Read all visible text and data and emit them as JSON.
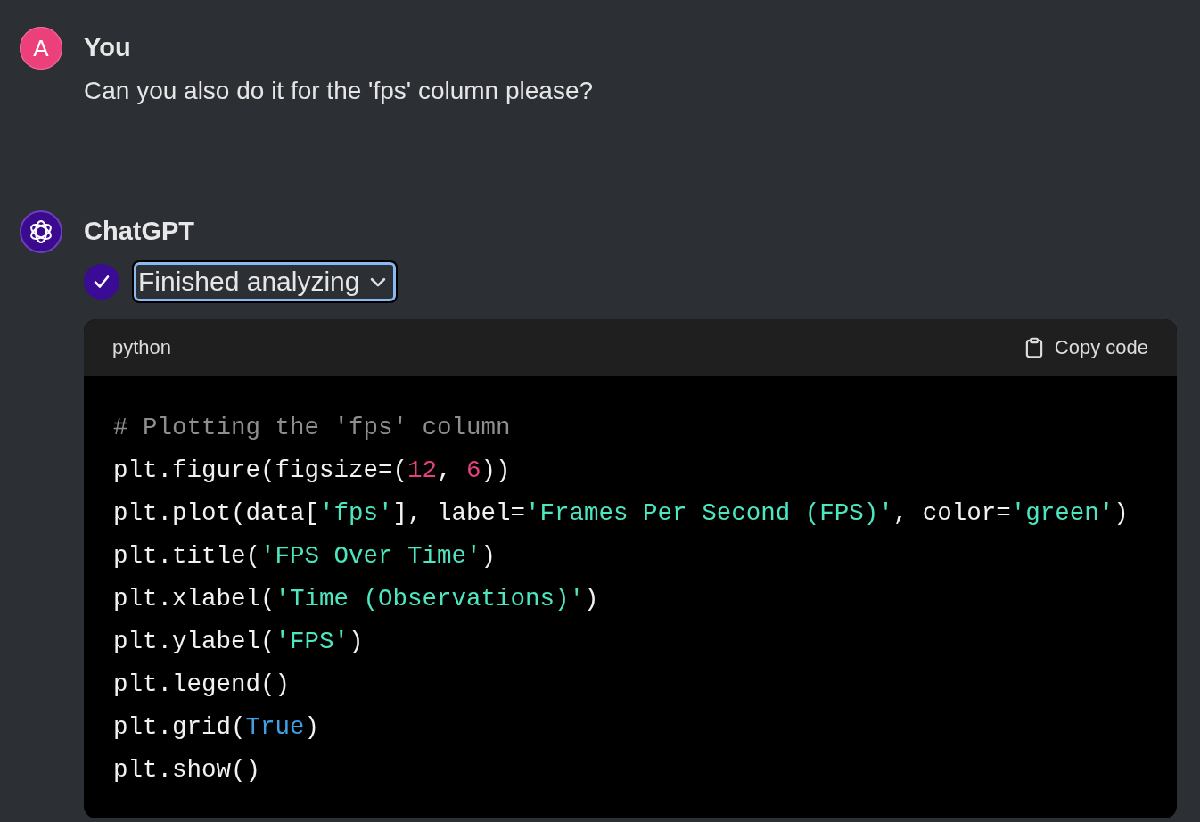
{
  "messages": [
    {
      "kind": "user",
      "avatar_letter": "A",
      "author": "You",
      "text": "Can you also do it for the 'fps' column please?"
    },
    {
      "kind": "assistant",
      "author": "ChatGPT",
      "status": {
        "label": "Finished analyzing",
        "expanded": false
      },
      "code_block": {
        "language": "python",
        "copy_label": "Copy code",
        "lines": [
          [
            {
              "kind": "comment",
              "text": "# Plotting the 'fps' column"
            }
          ],
          [
            {
              "kind": "plain",
              "text": "plt.figure(figsize=("
            },
            {
              "kind": "number",
              "text": "12"
            },
            {
              "kind": "plain",
              "text": ", "
            },
            {
              "kind": "number",
              "text": "6"
            },
            {
              "kind": "plain",
              "text": "))"
            }
          ],
          [
            {
              "kind": "plain",
              "text": "plt.plot(data["
            },
            {
              "kind": "string",
              "text": "'fps'"
            },
            {
              "kind": "plain",
              "text": "], label="
            },
            {
              "kind": "string",
              "text": "'Frames Per Second (FPS)'"
            },
            {
              "kind": "plain",
              "text": ", color="
            },
            {
              "kind": "string",
              "text": "'green'"
            },
            {
              "kind": "plain",
              "text": ")"
            }
          ],
          [
            {
              "kind": "plain",
              "text": "plt.title("
            },
            {
              "kind": "string",
              "text": "'FPS Over Time'"
            },
            {
              "kind": "plain",
              "text": ")"
            }
          ],
          [
            {
              "kind": "plain",
              "text": "plt.xlabel("
            },
            {
              "kind": "string",
              "text": "'Time (Observations)'"
            },
            {
              "kind": "plain",
              "text": ")"
            }
          ],
          [
            {
              "kind": "plain",
              "text": "plt.ylabel("
            },
            {
              "kind": "string",
              "text": "'FPS'"
            },
            {
              "kind": "plain",
              "text": ")"
            }
          ],
          [
            {
              "kind": "plain",
              "text": "plt.legend()"
            }
          ],
          [
            {
              "kind": "plain",
              "text": "plt.grid("
            },
            {
              "kind": "keyword",
              "text": "True"
            },
            {
              "kind": "plain",
              "text": ")"
            }
          ],
          [
            {
              "kind": "plain",
              "text": "plt.show()"
            }
          ]
        ]
      }
    }
  ]
}
